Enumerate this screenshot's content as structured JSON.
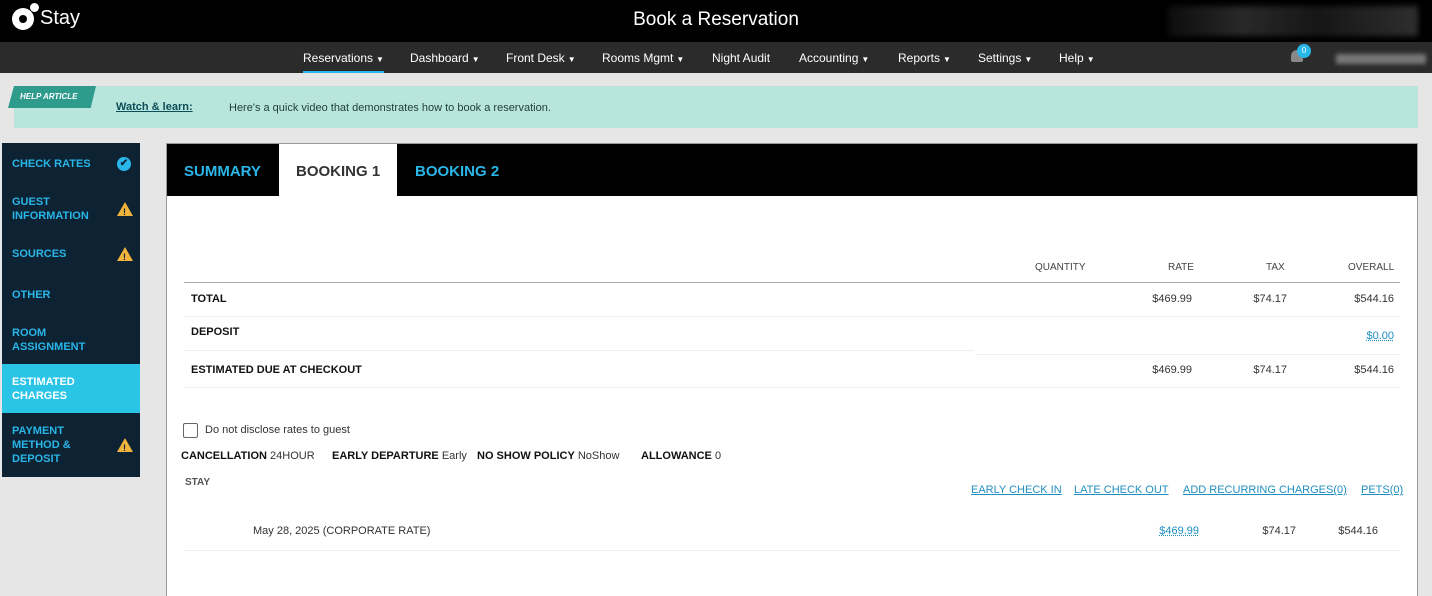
{
  "app": {
    "logo_text": "Stay",
    "page_title": "Book a Reservation"
  },
  "nav": {
    "items": [
      {
        "label": "Reservations",
        "caret": "▼"
      },
      {
        "label": "Dashboard",
        "caret": "▼"
      },
      {
        "label": "Front Desk",
        "caret": "▼"
      },
      {
        "label": "Rooms Mgmt",
        "caret": "▼"
      },
      {
        "label": "Night Audit",
        "caret": ""
      },
      {
        "label": "Accounting",
        "caret": "▼"
      },
      {
        "label": "Reports",
        "caret": "▼"
      },
      {
        "label": "Settings",
        "caret": "▼"
      },
      {
        "label": "Help",
        "caret": "▼"
      }
    ],
    "notification_count": "0"
  },
  "help": {
    "tag": "HELP ARTICLE",
    "link": "Watch & learn:",
    "text": "Here's a quick video that demonstrates how to book a reservation."
  },
  "sidebar": {
    "items": [
      {
        "label": "CHECK RATES",
        "status": "check-icon"
      },
      {
        "label": "GUEST INFORMATION",
        "status": "warning-icon"
      },
      {
        "label": "SOURCES",
        "status": "warning-icon"
      },
      {
        "label": "OTHER",
        "status": ""
      },
      {
        "label": "ROOM ASSIGNMENT",
        "status": ""
      },
      {
        "label": "ESTIMATED CHARGES",
        "status": "active"
      },
      {
        "label": "PAYMENT METHOD & DEPOSIT",
        "status": "warning-icon"
      }
    ]
  },
  "tabs": [
    {
      "label": "SUMMARY"
    },
    {
      "label": "BOOKING 1"
    },
    {
      "label": "BOOKING 2"
    }
  ],
  "charges": {
    "columns": [
      "QUANTITY",
      "RATE",
      "TAX",
      "OVERALL"
    ],
    "rows": [
      {
        "label": "TOTAL",
        "rate": "$469.99",
        "tax": "$74.17",
        "overall": "$544.16"
      },
      {
        "label": "DEPOSIT",
        "rate": "",
        "tax": "",
        "overall": "$0.00"
      },
      {
        "label": "ESTIMATED DUE AT CHECKOUT",
        "rate": "$469.99",
        "tax": "$74.17",
        "overall": "$544.16"
      }
    ]
  },
  "disclose_checkbox": {
    "label": "Do not disclose rates to guest",
    "checked": false
  },
  "policies": [
    {
      "key": "CANCELLATION",
      "value": "24HOUR"
    },
    {
      "key": "EARLY DEPARTURE",
      "value": "Early"
    },
    {
      "key": "NO SHOW POLICY",
      "value": "NoShow"
    },
    {
      "key": "ALLOWANCE",
      "value": "0"
    }
  ],
  "stay": {
    "label": "STAY",
    "actions": [
      "EARLY CHECK IN",
      "LATE CHECK OUT",
      "ADD RECURRING CHARGES(0)",
      "PETS(0)"
    ],
    "rows": [
      {
        "date": "May 28, 2025 (CORPORATE RATE)",
        "rate": "$469.99",
        "tax": "$74.17",
        "overall": "$544.16"
      }
    ]
  },
  "colors": {
    "accent": "#29b6e8",
    "sidebar_bg": "#0d2232",
    "warning": "#f0b43c",
    "help_bg": "#b8e6dc"
  }
}
